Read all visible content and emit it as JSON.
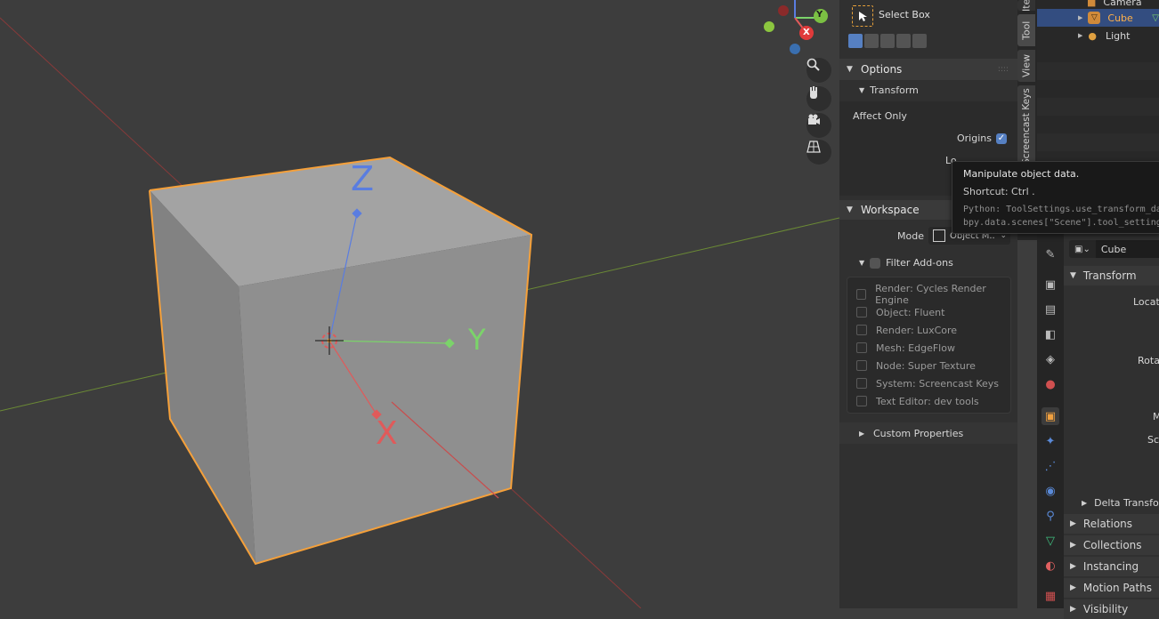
{
  "viewport": {
    "gizmo": {
      "y_label": "Y",
      "x_label": "X"
    },
    "axis_labels": {
      "z": "Z",
      "y": "Y",
      "x": "X"
    },
    "nav_buttons": [
      "zoom-icon",
      "hand-pan-icon",
      "camera-icon",
      "grid-perspective-icon"
    ]
  },
  "npanel": {
    "tool_name": "Select Box",
    "options_header": "Options",
    "transform_header": "Transform",
    "affect_only_label": "Affect Only",
    "origins_label": "Origins",
    "origins_checked": true,
    "locations_label_partial": "Lo",
    "workspace_header": "Workspace",
    "mode_label": "Mode",
    "mode_value": "Object M..",
    "filter_addons_label": "Filter Add-ons",
    "addons": [
      "Render: Cycles Render Engine",
      "Object: Fluent",
      "Render: LuxCore",
      "Mesh: EdgeFlow",
      "Node: Super Texture",
      "System: Screencast Keys",
      "Text Editor: dev tools"
    ],
    "custom_properties": "Custom Properties"
  },
  "vtabs": {
    "item": "Ite",
    "tool": "Tool",
    "view": "View",
    "screencast": "Screencast Keys"
  },
  "outliner": {
    "rows": [
      {
        "label": "Camera",
        "selected": false
      },
      {
        "label": "Cube",
        "selected": true
      },
      {
        "label": "Light",
        "selected": false
      }
    ]
  },
  "tooltip": {
    "title": "Manipulate object data.",
    "shortcut": "Shortcut: Ctrl .",
    "python1": "Python: ToolSettings.use_transform_da",
    "python2": "bpy.data.scenes[\"Scene\"].tool_setting"
  },
  "properties": {
    "object_name": "Cube",
    "transform_header": "Transform",
    "location_label": "Locati",
    "rotation_label": "Rotat",
    "mode_label_partial": "M",
    "scale_label": "Sc",
    "delta_transform": "Delta Transform",
    "relations": "Relations",
    "collections": "Collections",
    "instancing": "Instancing",
    "motion_paths": "Motion Paths",
    "visibility": "Visibility"
  },
  "colors": {
    "accent": "#5680c2",
    "selection": "#f5a03a",
    "x_axis": "#e05a5a",
    "y_axis": "#7bd36a",
    "z_axis": "#5a7de0"
  }
}
